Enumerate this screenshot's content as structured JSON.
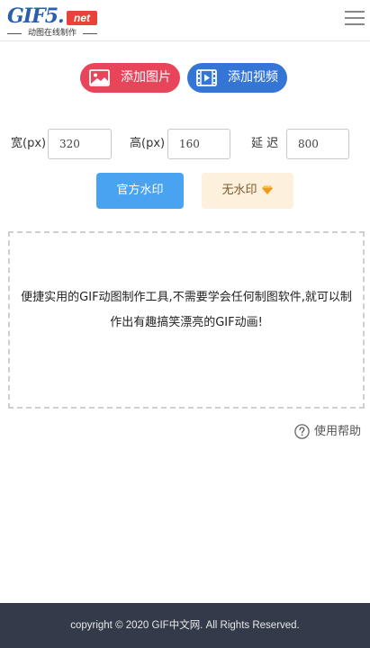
{
  "header": {
    "logo_main": "GIF5.",
    "logo_net": "net",
    "logo_sub": "动图在线制作"
  },
  "actions": {
    "add_image": "添加图片",
    "add_video": "添加视频"
  },
  "params": {
    "width_label": "宽(px)",
    "width_value": "320",
    "height_label": "高(px)",
    "height_value": "160",
    "delay_label": "延 迟",
    "delay_value": "800"
  },
  "watermark": {
    "official": "官方水印",
    "none": "无水印"
  },
  "dropzone": {
    "text": "便捷实用的GIF动图制作工具,不需要学会任何制图软件,就可以制作出有趣搞笑漂亮的GIF动画!"
  },
  "help": {
    "label": "使用帮助"
  },
  "footer": {
    "copyright": "copyright © 2020 GIF中文网. All Rights Reserved."
  },
  "colors": {
    "image_button": "#e8455a",
    "video_button": "#3575d6",
    "official_button": "#4aa3f0",
    "none_button": "#fdf0dc",
    "footer_bg": "#333b4a"
  },
  "icons": [
    "image-icon",
    "video-icon",
    "diamond-icon",
    "help-icon",
    "menu-icon"
  ]
}
